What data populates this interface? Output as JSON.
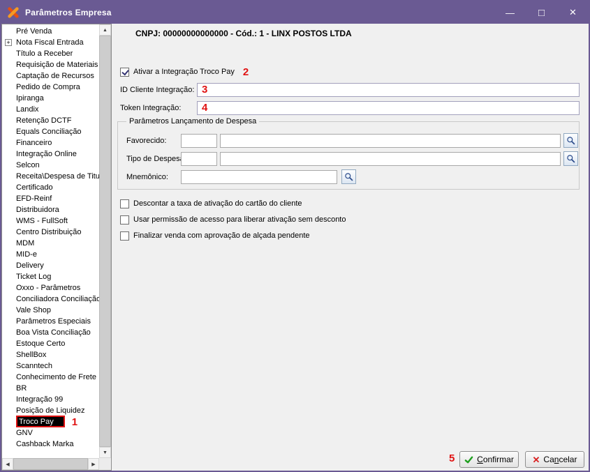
{
  "window": {
    "title": "Parâmetros Empresa"
  },
  "icons": {
    "app_logo": "linx-logo",
    "minimize": "—",
    "maximize": "□",
    "close": "✕",
    "expand": "+",
    "cancel_x": "✕",
    "scroll_up": "▲",
    "scroll_down": "▼",
    "scroll_left": "◀",
    "scroll_right": "▶"
  },
  "sidebar": {
    "items": [
      {
        "label": "Pré Venda"
      },
      {
        "label": "Nota Fiscal Entrada",
        "expandable": true
      },
      {
        "label": "Título a Receber"
      },
      {
        "label": "Requisição de Materiais"
      },
      {
        "label": "Captação de Recursos"
      },
      {
        "label": "Pedido de Compra"
      },
      {
        "label": "Ipiranga"
      },
      {
        "label": "Landix"
      },
      {
        "label": "Retenção DCTF"
      },
      {
        "label": "Equals Conciliação"
      },
      {
        "label": "Financeiro"
      },
      {
        "label": "Integração Online"
      },
      {
        "label": "Selcon"
      },
      {
        "label": "Receita\\Despesa de Titul"
      },
      {
        "label": "Certificado"
      },
      {
        "label": "EFD-Reinf"
      },
      {
        "label": "Distribuidora"
      },
      {
        "label": "WMS - FullSoft"
      },
      {
        "label": "Centro Distribuição"
      },
      {
        "label": "MDM"
      },
      {
        "label": "MID-e"
      },
      {
        "label": "Delivery"
      },
      {
        "label": "Ticket Log"
      },
      {
        "label": "Oxxo - Parâmetros"
      },
      {
        "label": "Conciliadora Conciliação"
      },
      {
        "label": "Vale Shop"
      },
      {
        "label": "Parâmetros Especiais"
      },
      {
        "label": "Boa Vista Conciliação"
      },
      {
        "label": "Estoque Certo"
      },
      {
        "label": "ShellBox"
      },
      {
        "label": "Scanntech"
      },
      {
        "label": "Conhecimento de Frete"
      },
      {
        "label": "BR"
      },
      {
        "label": "Integração 99"
      },
      {
        "label": "Posição de Liquidez"
      },
      {
        "label": "Troco Pay",
        "selected": true
      },
      {
        "label": "GNV"
      },
      {
        "label": "Cashback Marka"
      }
    ]
  },
  "main": {
    "header": "CNPJ: 00000000000000 - Cód.: 1 - LINX POSTOS LTDA",
    "activate": {
      "label": "Ativar a Integração Troco Pay",
      "checked": true
    },
    "id_field": {
      "label": "ID Cliente Integração:",
      "value": ""
    },
    "token_field": {
      "label": "Token Integração:",
      "value": ""
    },
    "expense_group": {
      "title": "Parâmetros Lançamento de Despesa",
      "favorecido_label": "Favorecido:",
      "tipo_label": "Tipo de Despesa:",
      "mnemonico_label": "Mnemônico:",
      "favorecido_code": "",
      "favorecido_desc": "",
      "tipo_code": "",
      "tipo_desc": "",
      "mnemonico_value": ""
    },
    "options": [
      {
        "label": "Descontar a taxa de ativação do cartão do cliente",
        "checked": false
      },
      {
        "label": "Usar permissão de acesso para liberar ativação sem desconto",
        "checked": false
      },
      {
        "label": "Finalizar venda com aprovação de alçada pendente",
        "checked": false
      }
    ],
    "buttons": {
      "confirm": {
        "pre": "",
        "accel": "C",
        "rest": "onfirmar"
      },
      "cancel": {
        "pre": "Ca",
        "accel": "n",
        "rest": "celar"
      }
    }
  },
  "annotations": {
    "sidebar_selected": "1",
    "activate": "2",
    "id_field": "3",
    "token_field": "4",
    "confirm": "5"
  },
  "colors": {
    "titlebar": "#6A5A93",
    "annotation_red": "#E01212",
    "selection_bg": "#000000",
    "confirm_check_green": "#1E9E1E",
    "cancel_x_red": "#D81E1E"
  }
}
